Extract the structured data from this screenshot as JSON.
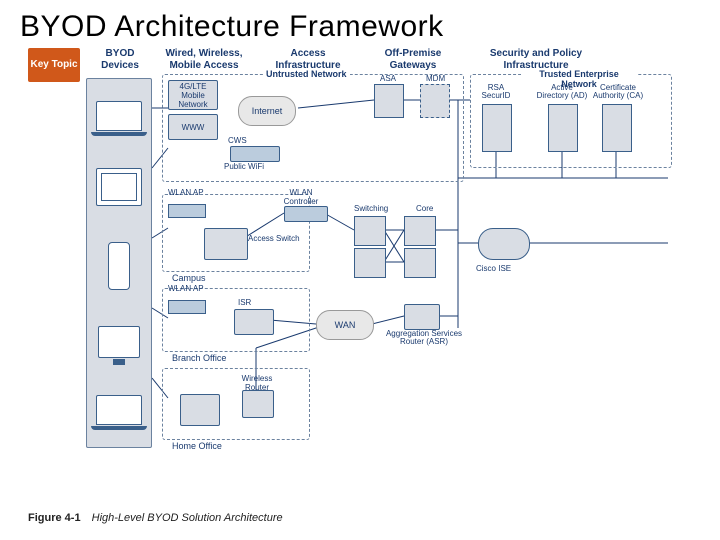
{
  "title": "BYOD Architecture Framework",
  "key_topic": "Key Topic",
  "columns": {
    "devices": "BYOD Devices",
    "access": "Wired, Wireless, Mobile Access",
    "infra": "Access Infrastructure",
    "gateways": "Off-Premise Gateways",
    "security": "Security and Policy Infrastructure"
  },
  "untrusted": {
    "label": "Untrusted Network",
    "lte": "4G/LTE Mobile Network",
    "www": "WWW",
    "internet": "Internet",
    "cws": "CWS",
    "public_wifi": "Public WiFi"
  },
  "gateways": {
    "asa": "ASA",
    "mdm": "MDM"
  },
  "trusted": {
    "label": "Trusted Enterprise Network",
    "rsa": "RSA SecurID",
    "ad": "Active Directory (AD)",
    "ca": "Certificate Authority (CA)"
  },
  "access_infra": {
    "wlan_ap": "WLAN AP",
    "wlc": "WLAN Controller",
    "switching": "Switching",
    "core": "Core",
    "access_switch": "Access Switch",
    "isr": "ISR",
    "wan": "WAN",
    "asr": "Aggregation Services Router (ASR)",
    "ise": "Cisco ISE",
    "wireless_router": "Wireless Router"
  },
  "locations": {
    "campus": "Campus",
    "branch": "Branch Office",
    "home": "Home Office"
  },
  "caption": {
    "fig": "Figure 4-1",
    "text": "High-Level BYOD Solution Architecture"
  }
}
